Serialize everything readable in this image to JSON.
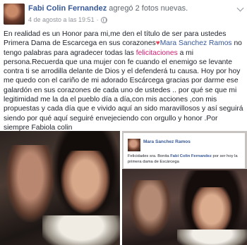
{
  "post": {
    "author": "Fabi Colin Fernandez",
    "action": "agregó 2 fotos nuevas.",
    "date": "4 de agosto a las 19:51",
    "dot": "·",
    "text_part1": "En realidad es un Honor para mi,me den el título de ser para ustedes Primera Dama de Escarcega en sus corazones",
    "heart": "♥",
    "mention": "Mara Sanchez Ramos",
    "text_part2": " no tengo palabras para agradecer todas las ",
    "highlight": "felicitaciones",
    "text_part3": " a mi persona.Recuerda que una mujer con fe cuando el enemigo se levante contra ti se arrodilla delante de Dios y el defenderá tu causa. Hoy por hoy me quedo con el cariño de mi adorado Escárcega gracias por darme ese galardón en sus corazones de cada uno de ustedes .. por qué se que mi legitimidad me la da el pueblo día a día,con mis acciones ,con mis propuestas y cada día que e vivido aquí an sido maravillosos y así seguirá siendo por qué aquí seguiré envejeciendo con orgullo y honor .Por siempre Fabiola colin"
  },
  "screenshot": {
    "name": "Mara Sanchez Ramos",
    "text_prefix": "Felicidades sra. Bonita ",
    "mention": "Fabi Colin Fernandez",
    "text_suffix": " por ser hoy la primera dama de Escárcega"
  }
}
